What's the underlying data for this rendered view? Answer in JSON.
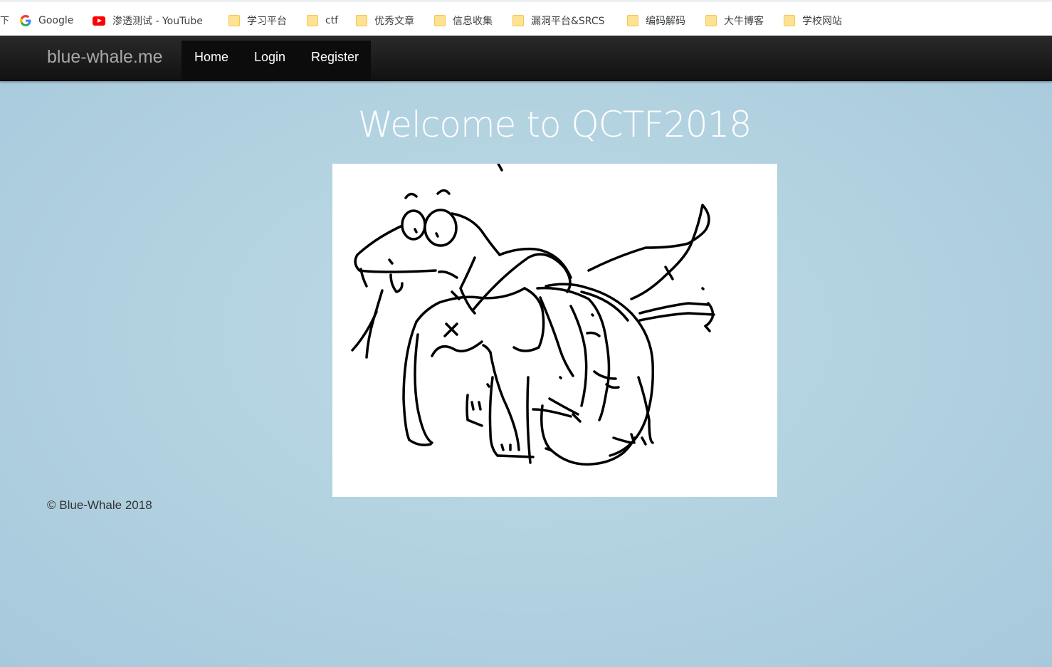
{
  "bookmarks_bar": {
    "edge_glyph": "下",
    "items": [
      {
        "label": "Google",
        "icon": "google-icon"
      },
      {
        "label": "渗透测试 - YouTube",
        "icon": "youtube-icon"
      },
      {
        "label": "学习平台",
        "icon": "folder-icon"
      },
      {
        "label": "ctf",
        "icon": "folder-icon"
      },
      {
        "label": "优秀文章",
        "icon": "folder-icon"
      },
      {
        "label": "信息收集",
        "icon": "folder-icon"
      },
      {
        "label": "漏洞平台&SRCS",
        "icon": "folder-icon"
      },
      {
        "label": "编码解码",
        "icon": "folder-icon"
      },
      {
        "label": "大牛博客",
        "icon": "folder-icon"
      },
      {
        "label": "学校网站",
        "icon": "folder-icon"
      }
    ]
  },
  "navbar": {
    "brand": "blue-whale.me",
    "links": [
      "Home",
      "Login",
      "Register"
    ]
  },
  "main": {
    "heading": "Welcome to QCTF2018",
    "image": "snake-swallowing-elephant-sketch"
  },
  "footer": {
    "text": "© Blue-Whale 2018"
  },
  "colors": {
    "navbar": "#111111",
    "page_background": "#b4d3e1",
    "heading": "#ffffff",
    "brand": "#a8a8a8"
  }
}
